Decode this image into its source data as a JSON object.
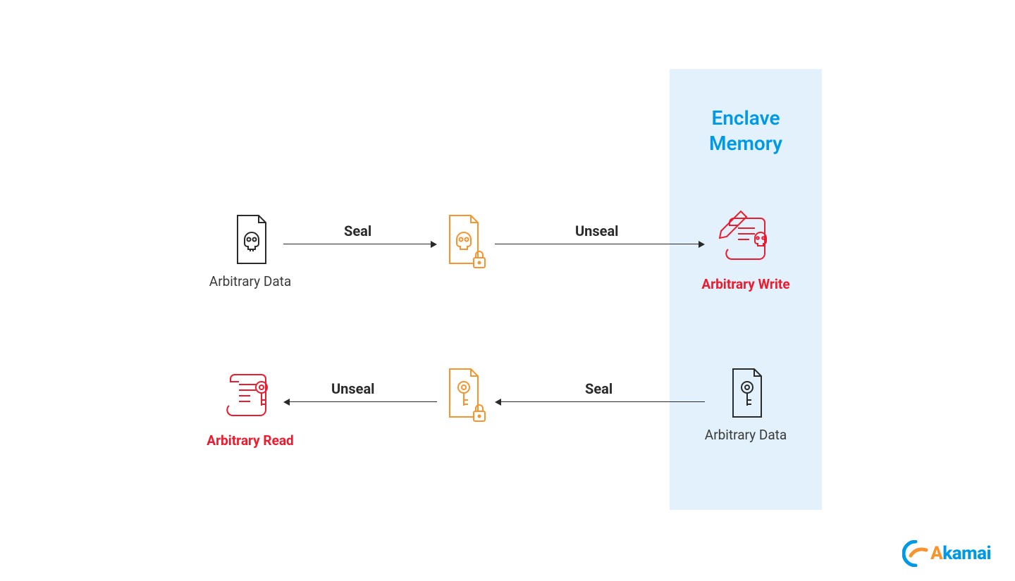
{
  "enclave": {
    "title_line1": "Enclave",
    "title_line2": "Memory"
  },
  "row1": {
    "left_label": "Arbitrary Data",
    "right_label": "Arbitrary Write",
    "arrow1_label": "Seal",
    "arrow2_label": "Unseal"
  },
  "row2": {
    "left_label": "Arbitrary Read",
    "right_label": "Arbitrary Data",
    "arrow1_label": "Unseal",
    "arrow2_label": "Seal"
  },
  "logo": {
    "brand": "kamai",
    "prefix": "A"
  },
  "colors": {
    "enclave_bg": "#e2f1fb",
    "enclave_text": "#0099e6",
    "danger": "#ed1b2e",
    "orange": "#f7942e",
    "dark": "#2a2a2a"
  }
}
